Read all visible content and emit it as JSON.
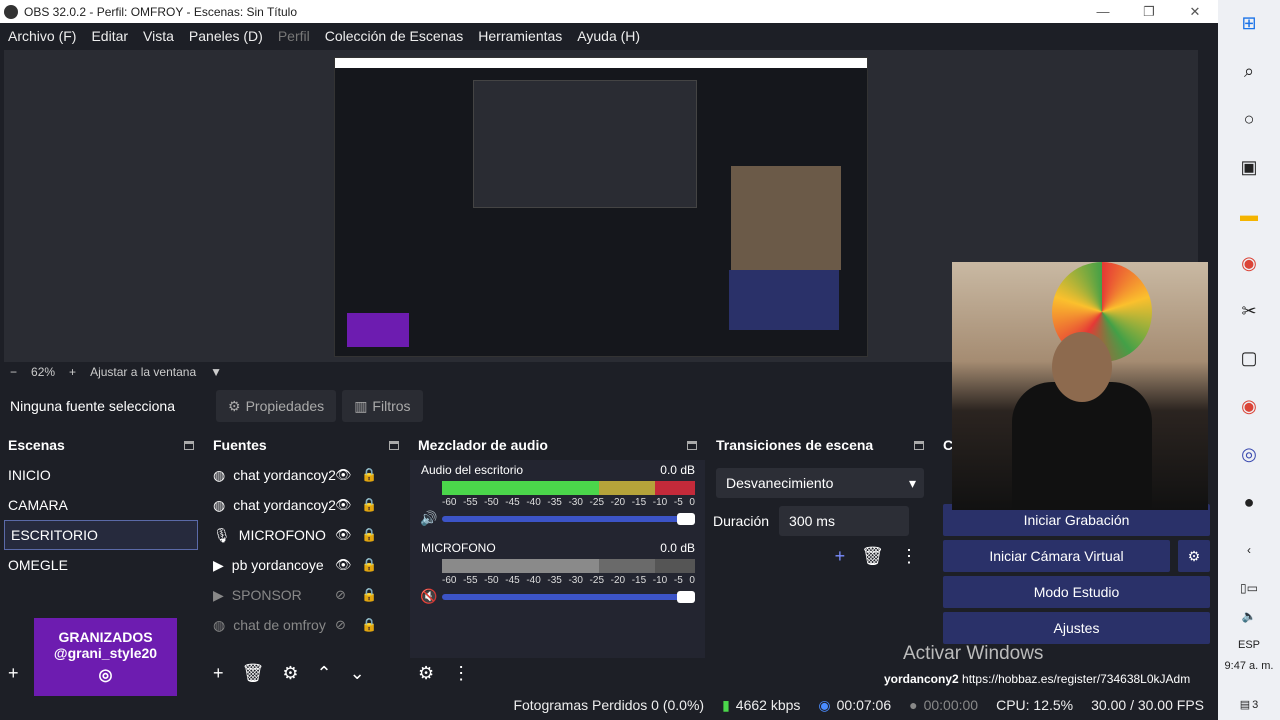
{
  "window": {
    "title": "OBS 32.0.2 - Perfil: OMFROY - Escenas: Sin Título",
    "minimize": "—",
    "maximize": "❐",
    "close": "✕"
  },
  "menu": [
    "Archivo (F)",
    "Editar",
    "Vista",
    "Paneles (D)",
    "Perfil",
    "Colección de Escenas",
    "Herramientas",
    "Ayuda (H)"
  ],
  "zoom": {
    "minus": "−",
    "value": "62%",
    "plus": "+",
    "fit": "Ajustar a la ventana",
    "caret": "▼"
  },
  "context": {
    "label": "Ninguna fuente selecciona",
    "properties": "Propiedades",
    "filters": "Filtros"
  },
  "scenes": {
    "title": "Escenas",
    "items": [
      "INICIO",
      "CAMARA",
      "ESCRITORIO",
      "OMEGLE"
    ],
    "selected": "ESCRITORIO"
  },
  "sources": {
    "title": "Fuentes",
    "items": [
      {
        "name": "chat yordancoy2",
        "icon": "browser-icon",
        "visible": true,
        "locked": true
      },
      {
        "name": "chat yordancoy2",
        "icon": "browser-icon",
        "visible": true,
        "locked": true
      },
      {
        "name": "MICROFONO",
        "icon": "mic-icon",
        "visible": true,
        "locked": true
      },
      {
        "name": "pb yordancoye",
        "icon": "media-icon",
        "visible": true,
        "locked": true
      },
      {
        "name": "SPONSOR",
        "icon": "media-icon",
        "visible": false,
        "locked": true
      },
      {
        "name": "chat de omfroy",
        "icon": "browser-icon",
        "visible": false,
        "locked": true
      }
    ]
  },
  "mixer": {
    "title": "Mezclador de audio",
    "channels": [
      {
        "name": "Audio del escritorio",
        "db": "0.0 dB",
        "level": 1.0
      },
      {
        "name": "MICROFONO",
        "db": "0.0 dB",
        "level": 1.0
      }
    ],
    "scale": [
      "-60",
      "-55",
      "-50",
      "-45",
      "-40",
      "-35",
      "-30",
      "-25",
      "-20",
      "-15",
      "-10",
      "-5",
      "0"
    ]
  },
  "transitions": {
    "title": "Transiciones de escena",
    "selected": "Desvanecimiento",
    "duration_label": "Duración",
    "duration_value": "300 ms"
  },
  "controls": {
    "title": "C",
    "record": "Iniciar Grabación",
    "virtualcam": "Iniciar Cámara Virtual",
    "studio": "Modo Estudio",
    "settings": "Ajustes"
  },
  "overlay": {
    "line1": "GRANIZADOS",
    "line2": "@grani_style20"
  },
  "watermark": "Activar Windows",
  "ticker": {
    "user": "yordancony2",
    "url": "https://hobbaz.es/register/734638L0kJAdm"
  },
  "status": {
    "dropped": "Fotogramas Perdidos 0 (0.0%)",
    "kbps": "4662 kbps",
    "stream_time": "00:07:06",
    "rec_time": "00:00:00",
    "cpu": "CPU: 12.5%",
    "fps": "30.00 / 30.00 FPS"
  },
  "taskbar": {
    "lang": "ESP",
    "time": "9:47 a. m.",
    "notif": "3"
  }
}
